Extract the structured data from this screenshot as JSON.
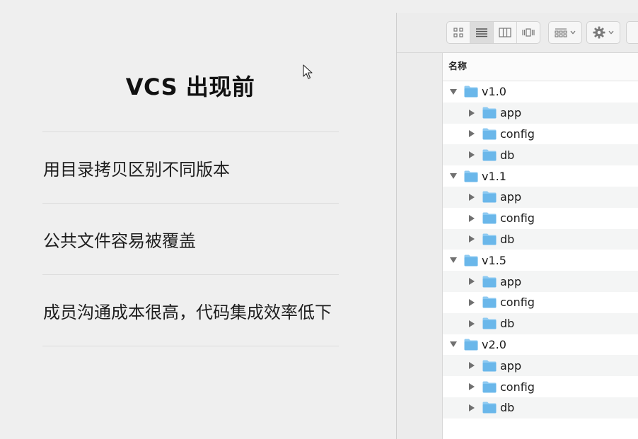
{
  "slide": {
    "title": "VCS 出现前",
    "bullets": [
      "用目录拷贝区别不同版本",
      "公共文件容易被覆盖",
      "成员沟通成本很高，代码集成效率低下"
    ]
  },
  "finder": {
    "toolbar": {
      "view_buttons": [
        "icon-view-icon",
        "list-view-icon",
        "column-view-icon",
        "cover-flow-icon"
      ],
      "active_view": "list-view-icon",
      "group_button": "group-by-icon",
      "action_button": "gear-icon"
    },
    "column_header": "名称",
    "rows": [
      {
        "name": "v1.0",
        "level": 0,
        "expanded": true
      },
      {
        "name": "app",
        "level": 1,
        "expanded": false
      },
      {
        "name": "config",
        "level": 1,
        "expanded": false
      },
      {
        "name": "db",
        "level": 1,
        "expanded": false
      },
      {
        "name": "v1.1",
        "level": 0,
        "expanded": true
      },
      {
        "name": "app",
        "level": 1,
        "expanded": false
      },
      {
        "name": "config",
        "level": 1,
        "expanded": false
      },
      {
        "name": "db",
        "level": 1,
        "expanded": false
      },
      {
        "name": "v1.5",
        "level": 0,
        "expanded": true
      },
      {
        "name": "app",
        "level": 1,
        "expanded": false
      },
      {
        "name": "config",
        "level": 1,
        "expanded": false
      },
      {
        "name": "db",
        "level": 1,
        "expanded": false
      },
      {
        "name": "v2.0",
        "level": 0,
        "expanded": true
      },
      {
        "name": "app",
        "level": 1,
        "expanded": false
      },
      {
        "name": "config",
        "level": 1,
        "expanded": false
      },
      {
        "name": "db",
        "level": 1,
        "expanded": false
      }
    ],
    "folder_color": "#6ab7ea",
    "folder_tab_color": "#8dcaf2"
  }
}
